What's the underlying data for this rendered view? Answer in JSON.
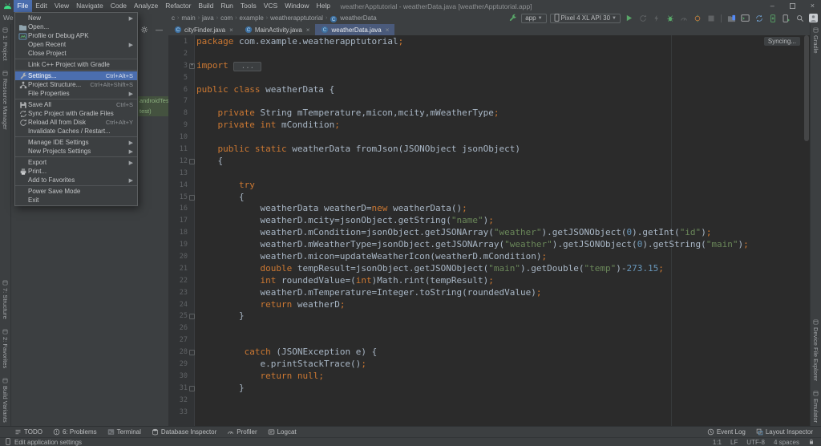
{
  "window": {
    "title": "weatherApptutorial - weatherData.java [weatherApptutorial.app]"
  },
  "menubar": {
    "active": "File",
    "items": [
      "File",
      "Edit",
      "View",
      "Navigate",
      "Code",
      "Analyze",
      "Refactor",
      "Build",
      "Run",
      "Tools",
      "VCS",
      "Window",
      "Help"
    ]
  },
  "file_menu": {
    "items": [
      {
        "label": "New",
        "arrow": true
      },
      {
        "label": "Open...",
        "icon": "folder"
      },
      {
        "label": "Profile or Debug APK",
        "icon": "apk"
      },
      {
        "label": "Open Recent",
        "arrow": true
      },
      {
        "label": "Close Project"
      },
      {
        "sep": true
      },
      {
        "label": "Link C++ Project with Gradle"
      },
      {
        "sep": true
      },
      {
        "label": "Settings...",
        "icon": "wrench",
        "shortcut": "Ctrl+Alt+S",
        "selected": true
      },
      {
        "label": "Project Structure...",
        "icon": "structure",
        "shortcut": "Ctrl+Alt+Shift+S"
      },
      {
        "label": "File Properties",
        "arrow": true
      },
      {
        "sep": true
      },
      {
        "label": "Save All",
        "icon": "floppy",
        "shortcut": "Ctrl+S"
      },
      {
        "label": "Sync Project with Gradle Files",
        "icon": "gradlesync"
      },
      {
        "label": "Reload All from Disk",
        "icon": "refresh",
        "shortcut": "Ctrl+Alt+Y"
      },
      {
        "label": "Invalidate Caches / Restart..."
      },
      {
        "sep": true
      },
      {
        "label": "Manage IDE Settings",
        "arrow": true
      },
      {
        "label": "New Projects Settings",
        "arrow": true
      },
      {
        "sep": true
      },
      {
        "label": "Export",
        "arrow": true
      },
      {
        "label": "Print...",
        "icon": "printer"
      },
      {
        "label": "Add to Favorites",
        "arrow": true
      },
      {
        "sep": true
      },
      {
        "label": "Power Save Mode"
      },
      {
        "label": "Exit"
      }
    ]
  },
  "navbar": {
    "left_fragment": "We",
    "crumbs": [
      "c",
      "main",
      "java",
      "com",
      "example",
      "weatherapptutorial",
      "weatherData"
    ]
  },
  "toolbar": {
    "run_config": "app",
    "device": "Pixel 4 XL API 30"
  },
  "tabs": {
    "items": [
      {
        "label": "cityFinder.java",
        "active": false
      },
      {
        "label": "MainActivity.java",
        "active": false
      },
      {
        "label": "weatherData.java",
        "active": true
      }
    ]
  },
  "project_panel": {
    "rows": [
      "androidTest)",
      "test)"
    ]
  },
  "editor": {
    "syncing_label": "Syncing...",
    "lines": [
      {
        "n": "1",
        "tokens": [
          [
            "k",
            "package "
          ],
          [
            "d",
            "com.example.weatherapptutorial"
          ],
          [
            "sc",
            ";"
          ]
        ]
      },
      {
        "n": "2",
        "tokens": []
      },
      {
        "n": "3",
        "fold": "plus",
        "tokens": [
          [
            "k",
            "import "
          ],
          [
            "f",
            " ... "
          ]
        ]
      },
      {
        "n": "5",
        "tokens": []
      },
      {
        "n": "6",
        "tokens": [
          [
            "k",
            "public class "
          ],
          [
            "d",
            "weatherData {"
          ]
        ]
      },
      {
        "n": "7",
        "tokens": []
      },
      {
        "n": "8",
        "tokens": [
          [
            "d",
            "    "
          ],
          [
            "k",
            "private "
          ],
          [
            "d",
            "String mTemperature,micon,mcity,mWeatherType"
          ],
          [
            "sc",
            ";"
          ]
        ]
      },
      {
        "n": "9",
        "tokens": [
          [
            "d",
            "    "
          ],
          [
            "k",
            "private int "
          ],
          [
            "d",
            "mCondition"
          ],
          [
            "sc",
            ";"
          ]
        ]
      },
      {
        "n": "10",
        "tokens": []
      },
      {
        "n": "11",
        "tokens": [
          [
            "d",
            "    "
          ],
          [
            "k",
            "public static "
          ],
          [
            "d",
            "weatherData fromJson(JSONObject jsonObject)"
          ]
        ]
      },
      {
        "n": "12",
        "fold": "minus",
        "tokens": [
          [
            "d",
            "    {"
          ]
        ]
      },
      {
        "n": "13",
        "tokens": []
      },
      {
        "n": "14",
        "tokens": [
          [
            "d",
            "        "
          ],
          [
            "k",
            "try"
          ]
        ]
      },
      {
        "n": "15",
        "fold": "minus",
        "tokens": [
          [
            "d",
            "        {"
          ]
        ]
      },
      {
        "n": "16",
        "tokens": [
          [
            "d",
            "            weatherData weatherD="
          ],
          [
            "k",
            "new"
          ],
          [
            "d",
            " weatherData()"
          ],
          [
            "sc",
            ";"
          ]
        ]
      },
      {
        "n": "17",
        "tokens": [
          [
            "d",
            "            weatherD.mcity=jsonObject.getString("
          ],
          [
            "s",
            "\"name\""
          ],
          [
            "d",
            ")"
          ],
          [
            "sc",
            ";"
          ]
        ]
      },
      {
        "n": "18",
        "tokens": [
          [
            "d",
            "            weatherD.mCondition=jsonObject.getJSONArray("
          ],
          [
            "s",
            "\"weather\""
          ],
          [
            "d",
            ").getJSONObject("
          ],
          [
            "n",
            "0"
          ],
          [
            "d",
            ").getInt("
          ],
          [
            "s",
            "\"id\""
          ],
          [
            "d",
            ")"
          ],
          [
            "sc",
            ";"
          ]
        ]
      },
      {
        "n": "19",
        "tokens": [
          [
            "d",
            "            weatherD.mWeatherType=jsonObject.getJSONArray("
          ],
          [
            "s",
            "\"weather\""
          ],
          [
            "d",
            ").getJSONObject("
          ],
          [
            "n",
            "0"
          ],
          [
            "d",
            ").getString("
          ],
          [
            "s",
            "\"main\""
          ],
          [
            "d",
            ")"
          ],
          [
            "sc",
            ";"
          ]
        ]
      },
      {
        "n": "20",
        "tokens": [
          [
            "d",
            "            weatherD.micon=updateWeatherIcon(weatherD.mCondition)"
          ],
          [
            "sc",
            ";"
          ]
        ]
      },
      {
        "n": "21",
        "tokens": [
          [
            "d",
            "            "
          ],
          [
            "k",
            "double"
          ],
          [
            "d",
            " tempResult=jsonObject.getJSONObject("
          ],
          [
            "s",
            "\"main\""
          ],
          [
            "d",
            ").getDouble("
          ],
          [
            "s",
            "\"temp\""
          ],
          [
            "d",
            ")-"
          ],
          [
            "n",
            "273.15"
          ],
          [
            "sc",
            ";"
          ]
        ]
      },
      {
        "n": "22",
        "tokens": [
          [
            "d",
            "            "
          ],
          [
            "k",
            "int"
          ],
          [
            "d",
            " roundedValue=("
          ],
          [
            "k",
            "int"
          ],
          [
            "d",
            ")Math.rint(tempResult)"
          ],
          [
            "sc",
            ";"
          ]
        ]
      },
      {
        "n": "23",
        "tokens": [
          [
            "d",
            "            weatherD.mTemperature=Integer.toString(roundedValue)"
          ],
          [
            "sc",
            ";"
          ]
        ]
      },
      {
        "n": "24",
        "tokens": [
          [
            "d",
            "            "
          ],
          [
            "k",
            "return"
          ],
          [
            "d",
            " weatherD"
          ],
          [
            "sc",
            ";"
          ]
        ]
      },
      {
        "n": "25",
        "fold": "minus",
        "tokens": [
          [
            "d",
            "        }"
          ]
        ]
      },
      {
        "n": "26",
        "tokens": []
      },
      {
        "n": "27",
        "tokens": []
      },
      {
        "n": "28",
        "fold": "minus",
        "tokens": [
          [
            "d",
            "         "
          ],
          [
            "k",
            "catch"
          ],
          [
            "d",
            " (JSONException e) {"
          ]
        ]
      },
      {
        "n": "29",
        "tokens": [
          [
            "d",
            "            e.printStackTrace()"
          ],
          [
            "sc",
            ";"
          ]
        ]
      },
      {
        "n": "30",
        "tokens": [
          [
            "d",
            "            "
          ],
          [
            "k",
            "return null"
          ],
          [
            "sc",
            ";"
          ]
        ]
      },
      {
        "n": "31",
        "fold": "minus",
        "tokens": [
          [
            "d",
            "        }"
          ]
        ]
      },
      {
        "n": "32",
        "tokens": []
      },
      {
        "n": "33",
        "tokens": []
      }
    ]
  },
  "left_bar": {
    "top": [
      "1: Project",
      "Resource Manager"
    ],
    "bottom": [
      "7: Structure",
      "2: Favorites",
      "Build Variants"
    ]
  },
  "right_bar": {
    "top": [
      "Gradle"
    ],
    "bottom": [
      "Device File Explorer",
      "Emulator"
    ]
  },
  "bottom_bar": {
    "left": [
      {
        "label": "TODO",
        "icon": "todo"
      },
      {
        "label": "6: Problems",
        "icon": "problems"
      },
      {
        "label": "Terminal",
        "icon": "terminal"
      },
      {
        "label": "Database Inspector",
        "icon": "database"
      },
      {
        "label": "Profiler",
        "icon": "gauge"
      },
      {
        "label": "Logcat",
        "icon": "logcat"
      }
    ],
    "right": [
      {
        "label": "Event Log",
        "icon": "eventlog"
      },
      {
        "label": "Layout Inspector",
        "icon": "layout"
      }
    ]
  },
  "statusbar": {
    "left": "Edit application settings",
    "right": [
      "1:1",
      "LF",
      "UTF-8",
      "4 spaces"
    ]
  },
  "colors": {
    "panel_bg": "#3C3F41",
    "editor_bg": "#2B2B2B",
    "selection_blue": "#4B6EAF",
    "active_tab": "#4A5A7B",
    "keyword": "#CC7832",
    "string": "#6A8759",
    "number": "#6897BB",
    "text": "#A9B7C6",
    "run_green": "#59A869",
    "test_green": "#8CB07F"
  }
}
